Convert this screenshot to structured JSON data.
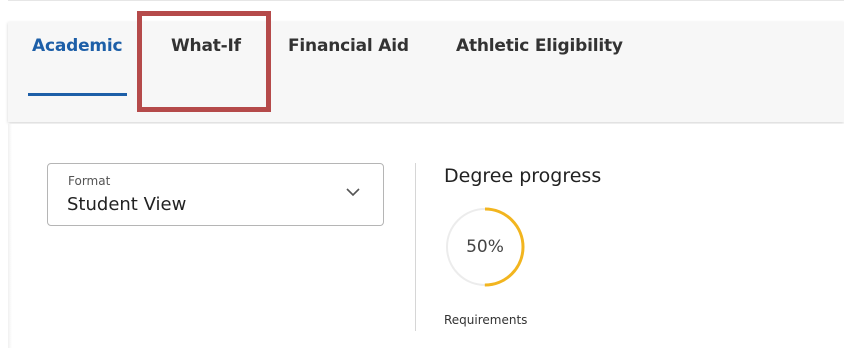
{
  "tabs": [
    {
      "label": "Academic",
      "active": true
    },
    {
      "label": "What-If",
      "active": false
    },
    {
      "label": "Financial Aid",
      "active": false
    },
    {
      "label": "Athletic Eligibility",
      "active": false
    }
  ],
  "colors": {
    "accent": "#1d5fa8",
    "highlight": "#b54a4a",
    "progress": "#f2b51f",
    "track": "#ececec"
  },
  "format": {
    "label": "Format",
    "value": "Student View",
    "icon": "chevron-down-icon"
  },
  "degree_progress": {
    "title": "Degree progress",
    "percent_text": "50%",
    "percent": 50,
    "caption": "Requirements"
  }
}
